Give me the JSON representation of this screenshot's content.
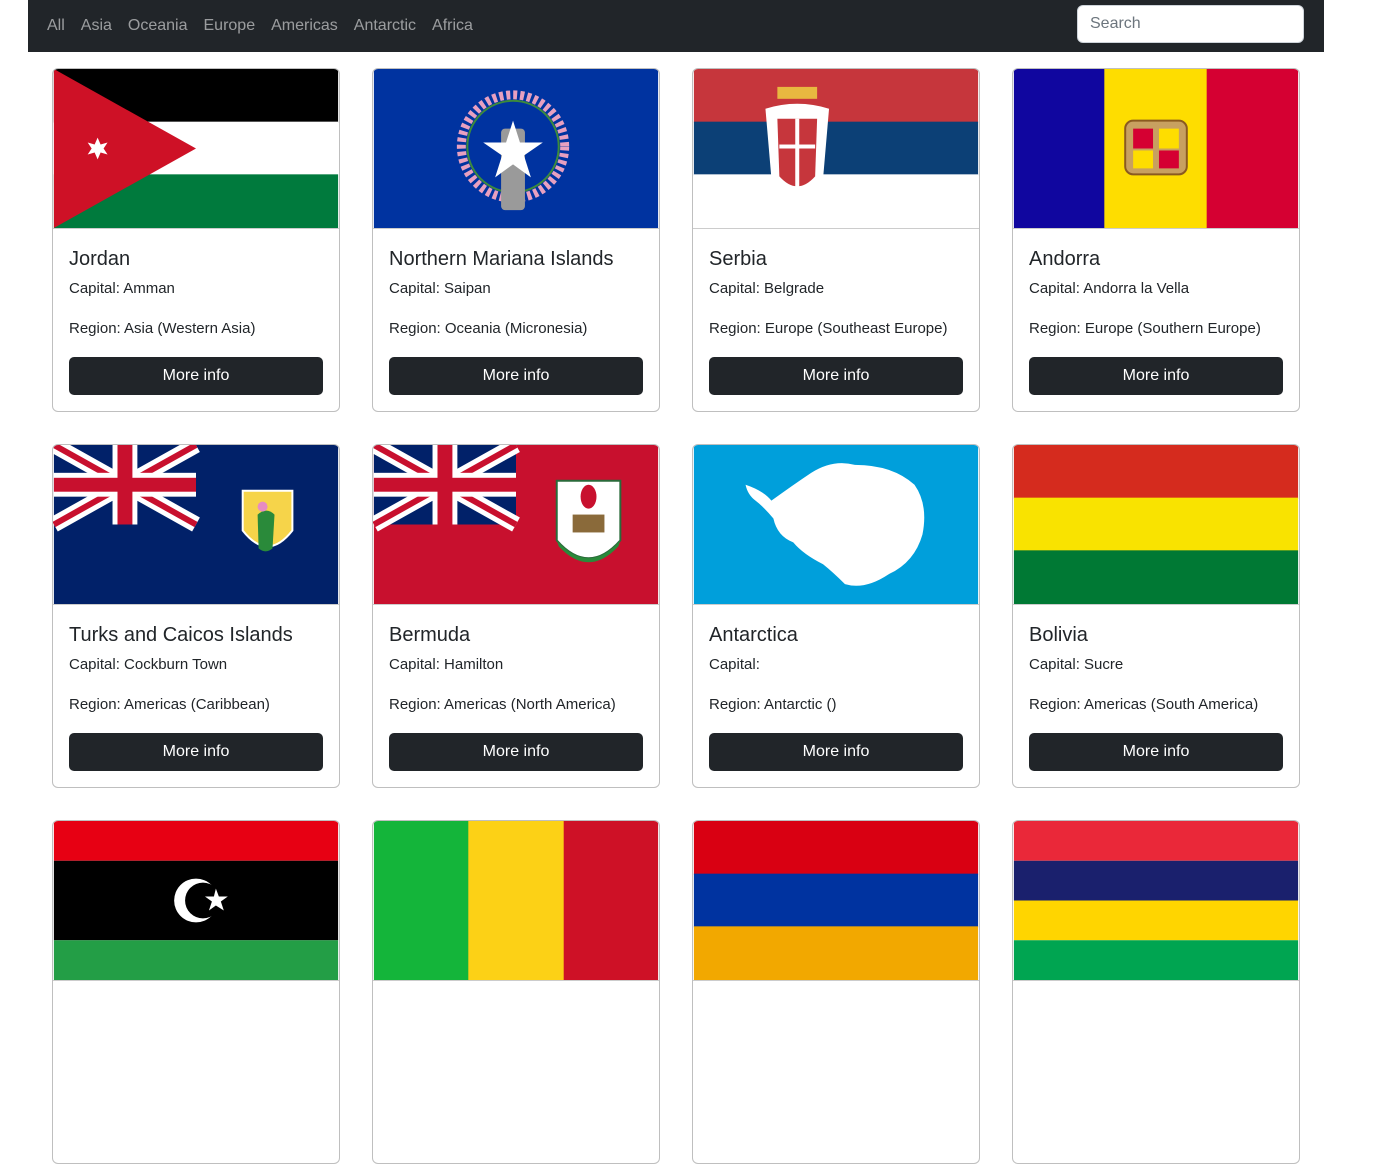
{
  "nav": {
    "links": [
      "All",
      "Asia",
      "Oceania",
      "Europe",
      "Americas",
      "Antarctic",
      "Africa"
    ],
    "search_placeholder": "Search"
  },
  "cards": [
    {
      "name": "Jordan",
      "capital": "Capital: Amman",
      "region": "Region: Asia (Western Asia)",
      "button": "More info"
    },
    {
      "name": "Northern Mariana Islands",
      "capital": "Capital: Saipan",
      "region": "Region: Oceania (Micronesia)",
      "button": "More info"
    },
    {
      "name": "Serbia",
      "capital": "Capital: Belgrade",
      "region": "Region: Europe (Southeast Europe)",
      "button": "More info"
    },
    {
      "name": "Andorra",
      "capital": "Capital: Andorra la Vella",
      "region": "Region: Europe (Southern Europe)",
      "button": "More info"
    },
    {
      "name": "Turks and Caicos Islands",
      "capital": "Capital: Cockburn Town",
      "region": "Region: Americas (Caribbean)",
      "button": "More info"
    },
    {
      "name": "Bermuda",
      "capital": "Capital: Hamilton",
      "region": "Region: Americas (North America)",
      "button": "More info"
    },
    {
      "name": "Antarctica",
      "capital": "Capital: ",
      "region": "Region: Antarctic ()",
      "button": "More info"
    },
    {
      "name": "Bolivia",
      "capital": "Capital: Sucre",
      "region": "Region: Americas (South America)",
      "button": "More info"
    },
    {
      "name": "",
      "capital": "",
      "region": "",
      "button": ""
    },
    {
      "name": "",
      "capital": "",
      "region": "",
      "button": ""
    },
    {
      "name": "",
      "capital": "",
      "region": "",
      "button": ""
    },
    {
      "name": "",
      "capital": "",
      "region": "",
      "button": ""
    }
  ],
  "colors": {
    "navbar": "#212529",
    "button": "#212529",
    "nav_link": "rgba(255,255,255,0.55)"
  }
}
